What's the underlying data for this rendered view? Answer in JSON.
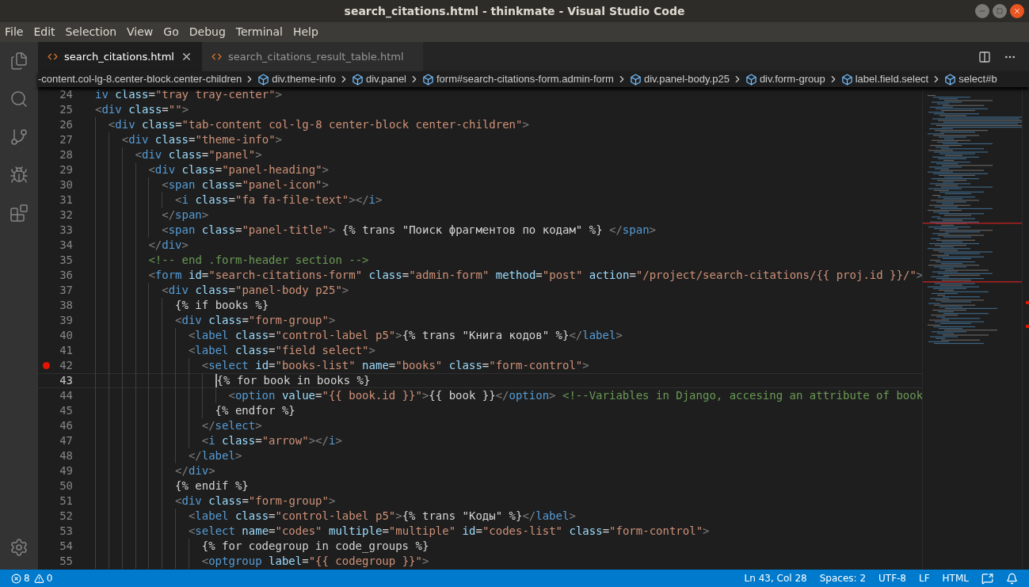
{
  "window": {
    "title": "search_citations.html - thinkmate - Visual Studio Code"
  },
  "menu": [
    "File",
    "Edit",
    "Selection",
    "View",
    "Go",
    "Debug",
    "Terminal",
    "Help"
  ],
  "tabs": [
    {
      "label": "search_citations.html",
      "selected": true
    },
    {
      "label": "search_citations_result_table.html",
      "selected": false
    }
  ],
  "breadcrumb": [
    {
      "label": "-content.col-lg-8.center-block.center-children",
      "kind": "text"
    },
    {
      "label": "div.theme-info",
      "kind": "element"
    },
    {
      "label": "div.panel",
      "kind": "element"
    },
    {
      "label": "form#search-citations-form.admin-form",
      "kind": "element"
    },
    {
      "label": "div.panel-body.p25",
      "kind": "element"
    },
    {
      "label": "div.form-group",
      "kind": "element"
    },
    {
      "label": "label.field.select",
      "kind": "element"
    },
    {
      "label": "select#b",
      "kind": "element"
    }
  ],
  "lines": [
    {
      "number": "24",
      "kind": "continuation",
      "text": "iv class=\"tray tray-center\">",
      "breakpoint": false,
      "current": false
    },
    {
      "number": "25",
      "kind": "code",
      "text": "<div class=\"\">",
      "breakpoint": false,
      "current": false
    },
    {
      "number": "26",
      "kind": "code",
      "text": "  <div class=\"tab-content col-lg-8 center-block center-children\">",
      "breakpoint": false,
      "current": false
    },
    {
      "number": "27",
      "kind": "code",
      "text": "    <div class=\"theme-info\">",
      "breakpoint": false,
      "current": false
    },
    {
      "number": "28",
      "kind": "code",
      "text": "      <div class=\"panel\">",
      "breakpoint": false,
      "current": false
    },
    {
      "number": "29",
      "kind": "code",
      "text": "        <div class=\"panel-heading\">",
      "breakpoint": false,
      "current": false
    },
    {
      "number": "30",
      "kind": "code",
      "text": "          <span class=\"panel-icon\">",
      "breakpoint": false,
      "current": false
    },
    {
      "number": "31",
      "kind": "code",
      "text": "            <i class=\"fa fa-file-text\"></i>",
      "breakpoint": false,
      "current": false
    },
    {
      "number": "32",
      "kind": "code",
      "text": "          </span>",
      "breakpoint": false,
      "current": false
    },
    {
      "number": "33",
      "kind": "code",
      "text": "          <span class=\"panel-title\"> {% trans \"Поиск фрагментов по кодам\" %} </span>",
      "breakpoint": false,
      "current": false
    },
    {
      "number": "34",
      "kind": "code",
      "text": "        </div>",
      "breakpoint": false,
      "current": false
    },
    {
      "number": "35",
      "kind": "code",
      "text": "        <!-- end .form-header section -->",
      "breakpoint": false,
      "current": false
    },
    {
      "number": "36",
      "kind": "code",
      "text": "        <form id=\"search-citations-form\" class=\"admin-form\" method=\"post\" action=\"/project/search-citations/{{ proj.id }}/\">",
      "breakpoint": false,
      "current": false
    },
    {
      "number": "37",
      "kind": "code",
      "text": "          <div class=\"panel-body p25\">",
      "breakpoint": false,
      "current": false
    },
    {
      "number": "38",
      "kind": "code",
      "text": "            {% if books %}",
      "breakpoint": false,
      "current": false
    },
    {
      "number": "39",
      "kind": "code",
      "text": "            <div class=\"form-group\">",
      "breakpoint": false,
      "current": false
    },
    {
      "number": "40",
      "kind": "code",
      "text": "              <label class=\"control-label p5\">{% trans \"Книга кодов\" %}</label>",
      "breakpoint": false,
      "current": false
    },
    {
      "number": "41",
      "kind": "code",
      "text": "              <label class=\"field select\">",
      "breakpoint": false,
      "current": false
    },
    {
      "number": "42",
      "kind": "code",
      "text": "                <select id=\"books-list\" name=\"books\" class=\"form-control\">",
      "breakpoint": true,
      "current": false
    },
    {
      "number": "43",
      "kind": "code",
      "text": "                  {% for book in books %}",
      "breakpoint": false,
      "current": true
    },
    {
      "number": "44",
      "kind": "code",
      "text": "                    <option value=\"{{ book.id }}\">{{ book }}</option> <!--Variables in Django, accesing an attribute of book",
      "breakpoint": false,
      "current": false
    },
    {
      "number": "45",
      "kind": "code",
      "text": "                  {% endfor %}",
      "breakpoint": false,
      "current": false
    },
    {
      "number": "46",
      "kind": "code",
      "text": "                </select>",
      "breakpoint": false,
      "current": false
    },
    {
      "number": "47",
      "kind": "code",
      "text": "                <i class=\"arrow\"></i>",
      "breakpoint": false,
      "current": false
    },
    {
      "number": "48",
      "kind": "code",
      "text": "              </label>",
      "breakpoint": false,
      "current": false
    },
    {
      "number": "49",
      "kind": "code",
      "text": "            </div>",
      "breakpoint": false,
      "current": false
    },
    {
      "number": "50",
      "kind": "code",
      "text": "            {% endif %}",
      "breakpoint": false,
      "current": false
    },
    {
      "number": "51",
      "kind": "code",
      "text": "            <div class=\"form-group\">",
      "breakpoint": false,
      "current": false
    },
    {
      "number": "52",
      "kind": "code",
      "text": "              <label class=\"control-label p5\">{% trans \"Коды\" %}</label>",
      "breakpoint": false,
      "current": false
    },
    {
      "number": "53",
      "kind": "code",
      "text": "              <select name=\"codes\" multiple=\"multiple\" id=\"codes-list\" class=\"form-control\">",
      "breakpoint": false,
      "current": false
    },
    {
      "number": "54",
      "kind": "code",
      "text": "                {% for codegroup in code_groups %}",
      "breakpoint": false,
      "current": false
    },
    {
      "number": "55",
      "kind": "code",
      "text": "                <optgroup label=\"{{ codegroup }}\">",
      "breakpoint": false,
      "current": false
    }
  ],
  "status_bar": {
    "errors": "8",
    "warnings": "0",
    "items": [
      "Ln 43, Col 28",
      "Spaces: 2",
      "UTF-8",
      "LF",
      "HTML"
    ]
  }
}
